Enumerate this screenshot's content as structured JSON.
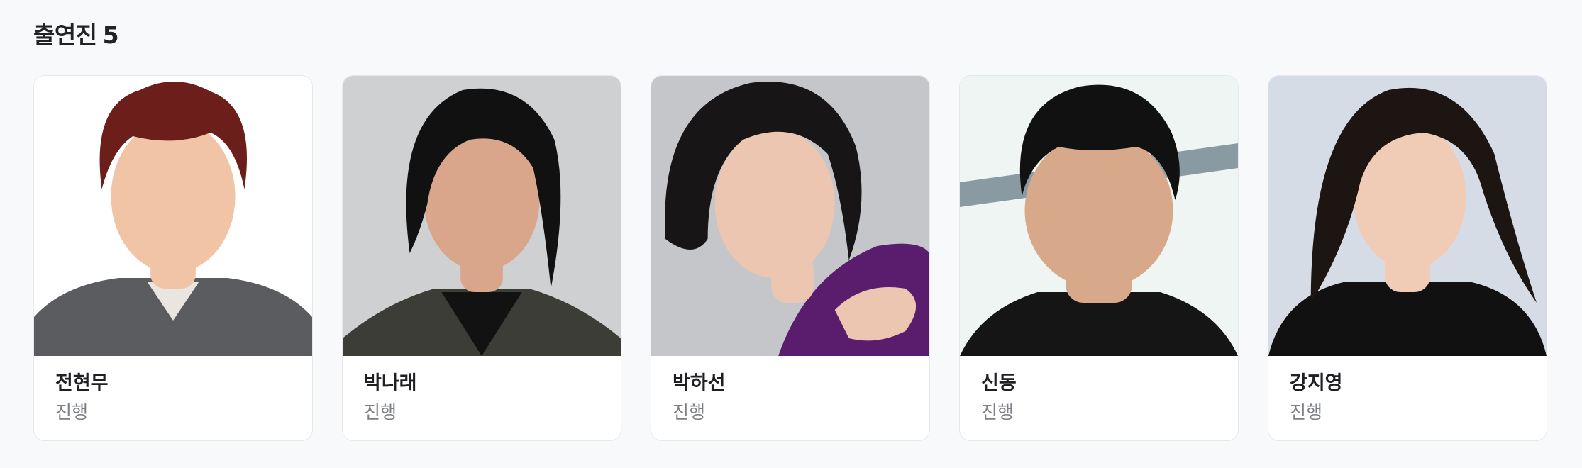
{
  "section": {
    "title": "출연진",
    "count": "5"
  },
  "cast": [
    {
      "name": "전현무",
      "role": "진행",
      "photo_bg": "#ffffff",
      "hair": "#6b1e1a",
      "skin": "#f1c4a6",
      "shirt": "#5a5c60"
    },
    {
      "name": "박나래",
      "role": "진행",
      "photo_bg": "#cfd0d2",
      "hair": "#111111",
      "skin": "#d9a68c",
      "shirt": "#121212"
    },
    {
      "name": "박하선",
      "role": "진행",
      "photo_bg": "#c4c6ca",
      "hair": "#171515",
      "skin": "#edc6b2",
      "shirt": "#5a1d6e"
    },
    {
      "name": "신동",
      "role": "진행",
      "photo_bg": "#eef5f3",
      "hair": "#111111",
      "skin": "#d7a98a",
      "shirt": "#151515"
    },
    {
      "name": "강지영",
      "role": "진행",
      "photo_bg": "#d6dce6",
      "hair": "#1c1512",
      "skin": "#f0cbb5",
      "shirt": "#111111"
    }
  ]
}
